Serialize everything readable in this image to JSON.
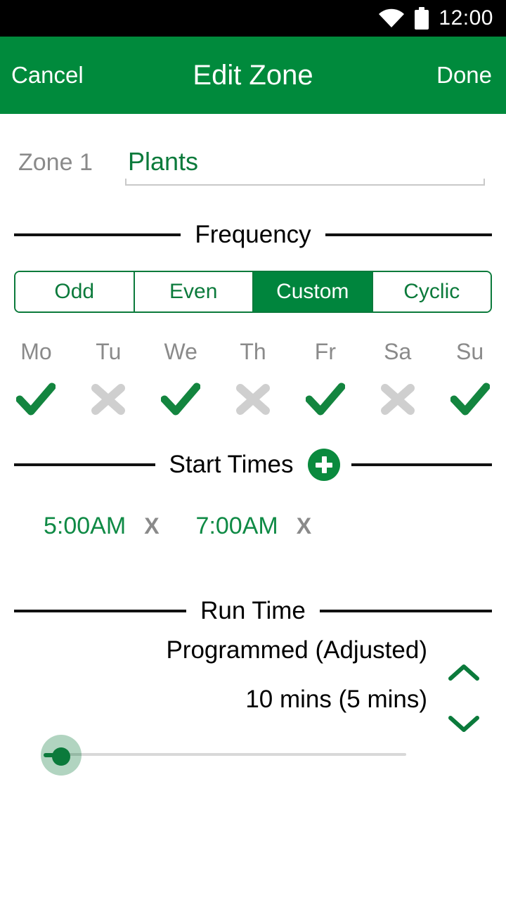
{
  "status_bar": {
    "time": "12:00",
    "wifi_icon": "wifi-icon",
    "battery_icon": "battery-full-icon"
  },
  "appbar": {
    "cancel_label": "Cancel",
    "title": "Edit Zone",
    "done_label": "Done",
    "background_color": "#008A3C"
  },
  "zone": {
    "label": "Zone 1",
    "name_value": "Plants",
    "name_placeholder": "Zone Name"
  },
  "frequency": {
    "section_title": "Frequency",
    "options": [
      {
        "label": "Odd",
        "selected": false
      },
      {
        "label": "Even",
        "selected": false
      },
      {
        "label": "Custom",
        "selected": true
      },
      {
        "label": "Cyclic",
        "selected": false
      }
    ],
    "days": [
      {
        "label": "Mo",
        "enabled": true,
        "icon": "check-icon"
      },
      {
        "label": "Tu",
        "enabled": false,
        "icon": "cross-icon"
      },
      {
        "label": "We",
        "enabled": true,
        "icon": "check-icon"
      },
      {
        "label": "Th",
        "enabled": false,
        "icon": "cross-icon"
      },
      {
        "label": "Fr",
        "enabled": true,
        "icon": "check-icon"
      },
      {
        "label": "Sa",
        "enabled": false,
        "icon": "cross-icon"
      },
      {
        "label": "Su",
        "enabled": true,
        "icon": "check-icon"
      }
    ]
  },
  "start_times": {
    "section_title": "Start Times",
    "add_icon": "plus-circle-icon",
    "times": [
      {
        "value": "5:00AM",
        "delete_label": "X"
      },
      {
        "value": "7:00AM",
        "delete_label": "X"
      }
    ]
  },
  "run_time": {
    "section_title": "Run Time",
    "programmed_label": "Programmed (Adjusted)",
    "duration_label": "10 mins (5 mins)",
    "increase_icon": "chevron-up-icon",
    "decrease_icon": "chevron-down-icon",
    "slider": {
      "percent": 4,
      "accent_color": "#0b7a3b"
    }
  },
  "colors": {
    "brand_green": "#008A3C",
    "text_green": "#0b7a3b",
    "muted_gray": "#8a8a8a"
  }
}
